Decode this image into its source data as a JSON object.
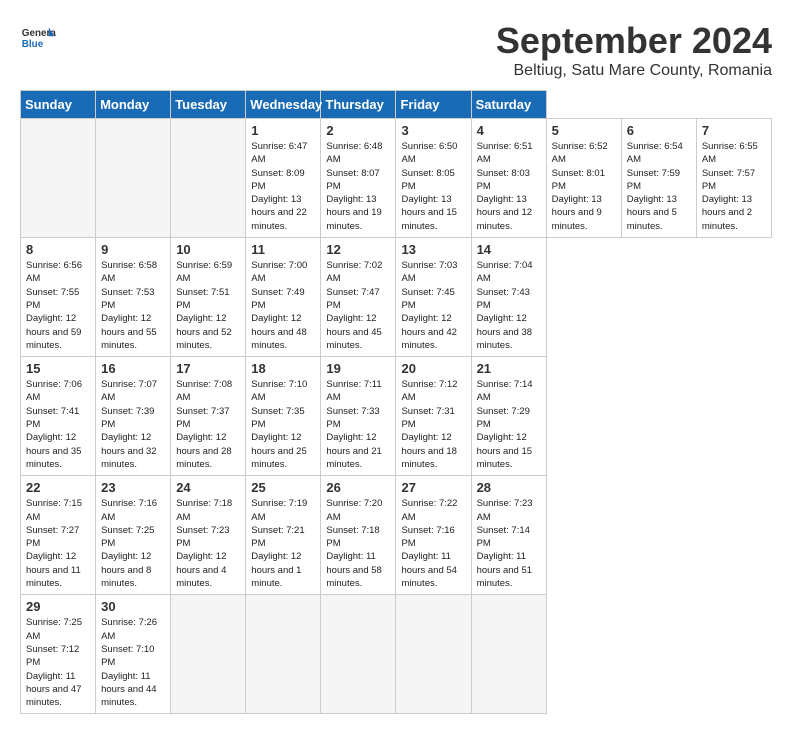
{
  "header": {
    "logo_general": "General",
    "logo_blue": "Blue",
    "month_year": "September 2024",
    "location": "Beltiug, Satu Mare County, Romania"
  },
  "calendar": {
    "days_of_week": [
      "Sunday",
      "Monday",
      "Tuesday",
      "Wednesday",
      "Thursday",
      "Friday",
      "Saturday"
    ],
    "weeks": [
      [
        null,
        null,
        null,
        {
          "day": 1,
          "rise": "6:47 AM",
          "set": "8:09 PM",
          "daylight": "13 hours and 22 minutes."
        },
        {
          "day": 2,
          "rise": "6:48 AM",
          "set": "8:07 PM",
          "daylight": "13 hours and 19 minutes."
        },
        {
          "day": 3,
          "rise": "6:50 AM",
          "set": "8:05 PM",
          "daylight": "13 hours and 15 minutes."
        },
        {
          "day": 4,
          "rise": "6:51 AM",
          "set": "8:03 PM",
          "daylight": "13 hours and 12 minutes."
        },
        {
          "day": 5,
          "rise": "6:52 AM",
          "set": "8:01 PM",
          "daylight": "13 hours and 9 minutes."
        },
        {
          "day": 6,
          "rise": "6:54 AM",
          "set": "7:59 PM",
          "daylight": "13 hours and 5 minutes."
        },
        {
          "day": 7,
          "rise": "6:55 AM",
          "set": "7:57 PM",
          "daylight": "13 hours and 2 minutes."
        }
      ],
      [
        {
          "day": 8,
          "rise": "6:56 AM",
          "set": "7:55 PM",
          "daylight": "12 hours and 59 minutes."
        },
        {
          "day": 9,
          "rise": "6:58 AM",
          "set": "7:53 PM",
          "daylight": "12 hours and 55 minutes."
        },
        {
          "day": 10,
          "rise": "6:59 AM",
          "set": "7:51 PM",
          "daylight": "12 hours and 52 minutes."
        },
        {
          "day": 11,
          "rise": "7:00 AM",
          "set": "7:49 PM",
          "daylight": "12 hours and 48 minutes."
        },
        {
          "day": 12,
          "rise": "7:02 AM",
          "set": "7:47 PM",
          "daylight": "12 hours and 45 minutes."
        },
        {
          "day": 13,
          "rise": "7:03 AM",
          "set": "7:45 PM",
          "daylight": "12 hours and 42 minutes."
        },
        {
          "day": 14,
          "rise": "7:04 AM",
          "set": "7:43 PM",
          "daylight": "12 hours and 38 minutes."
        }
      ],
      [
        {
          "day": 15,
          "rise": "7:06 AM",
          "set": "7:41 PM",
          "daylight": "12 hours and 35 minutes."
        },
        {
          "day": 16,
          "rise": "7:07 AM",
          "set": "7:39 PM",
          "daylight": "12 hours and 32 minutes."
        },
        {
          "day": 17,
          "rise": "7:08 AM",
          "set": "7:37 PM",
          "daylight": "12 hours and 28 minutes."
        },
        {
          "day": 18,
          "rise": "7:10 AM",
          "set": "7:35 PM",
          "daylight": "12 hours and 25 minutes."
        },
        {
          "day": 19,
          "rise": "7:11 AM",
          "set": "7:33 PM",
          "daylight": "12 hours and 21 minutes."
        },
        {
          "day": 20,
          "rise": "7:12 AM",
          "set": "7:31 PM",
          "daylight": "12 hours and 18 minutes."
        },
        {
          "day": 21,
          "rise": "7:14 AM",
          "set": "7:29 PM",
          "daylight": "12 hours and 15 minutes."
        }
      ],
      [
        {
          "day": 22,
          "rise": "7:15 AM",
          "set": "7:27 PM",
          "daylight": "12 hours and 11 minutes."
        },
        {
          "day": 23,
          "rise": "7:16 AM",
          "set": "7:25 PM",
          "daylight": "12 hours and 8 minutes."
        },
        {
          "day": 24,
          "rise": "7:18 AM",
          "set": "7:23 PM",
          "daylight": "12 hours and 4 minutes."
        },
        {
          "day": 25,
          "rise": "7:19 AM",
          "set": "7:21 PM",
          "daylight": "12 hours and 1 minute."
        },
        {
          "day": 26,
          "rise": "7:20 AM",
          "set": "7:18 PM",
          "daylight": "11 hours and 58 minutes."
        },
        {
          "day": 27,
          "rise": "7:22 AM",
          "set": "7:16 PM",
          "daylight": "11 hours and 54 minutes."
        },
        {
          "day": 28,
          "rise": "7:23 AM",
          "set": "7:14 PM",
          "daylight": "11 hours and 51 minutes."
        }
      ],
      [
        {
          "day": 29,
          "rise": "7:25 AM",
          "set": "7:12 PM",
          "daylight": "11 hours and 47 minutes."
        },
        {
          "day": 30,
          "rise": "7:26 AM",
          "set": "7:10 PM",
          "daylight": "11 hours and 44 minutes."
        },
        null,
        null,
        null,
        null,
        null
      ]
    ]
  }
}
